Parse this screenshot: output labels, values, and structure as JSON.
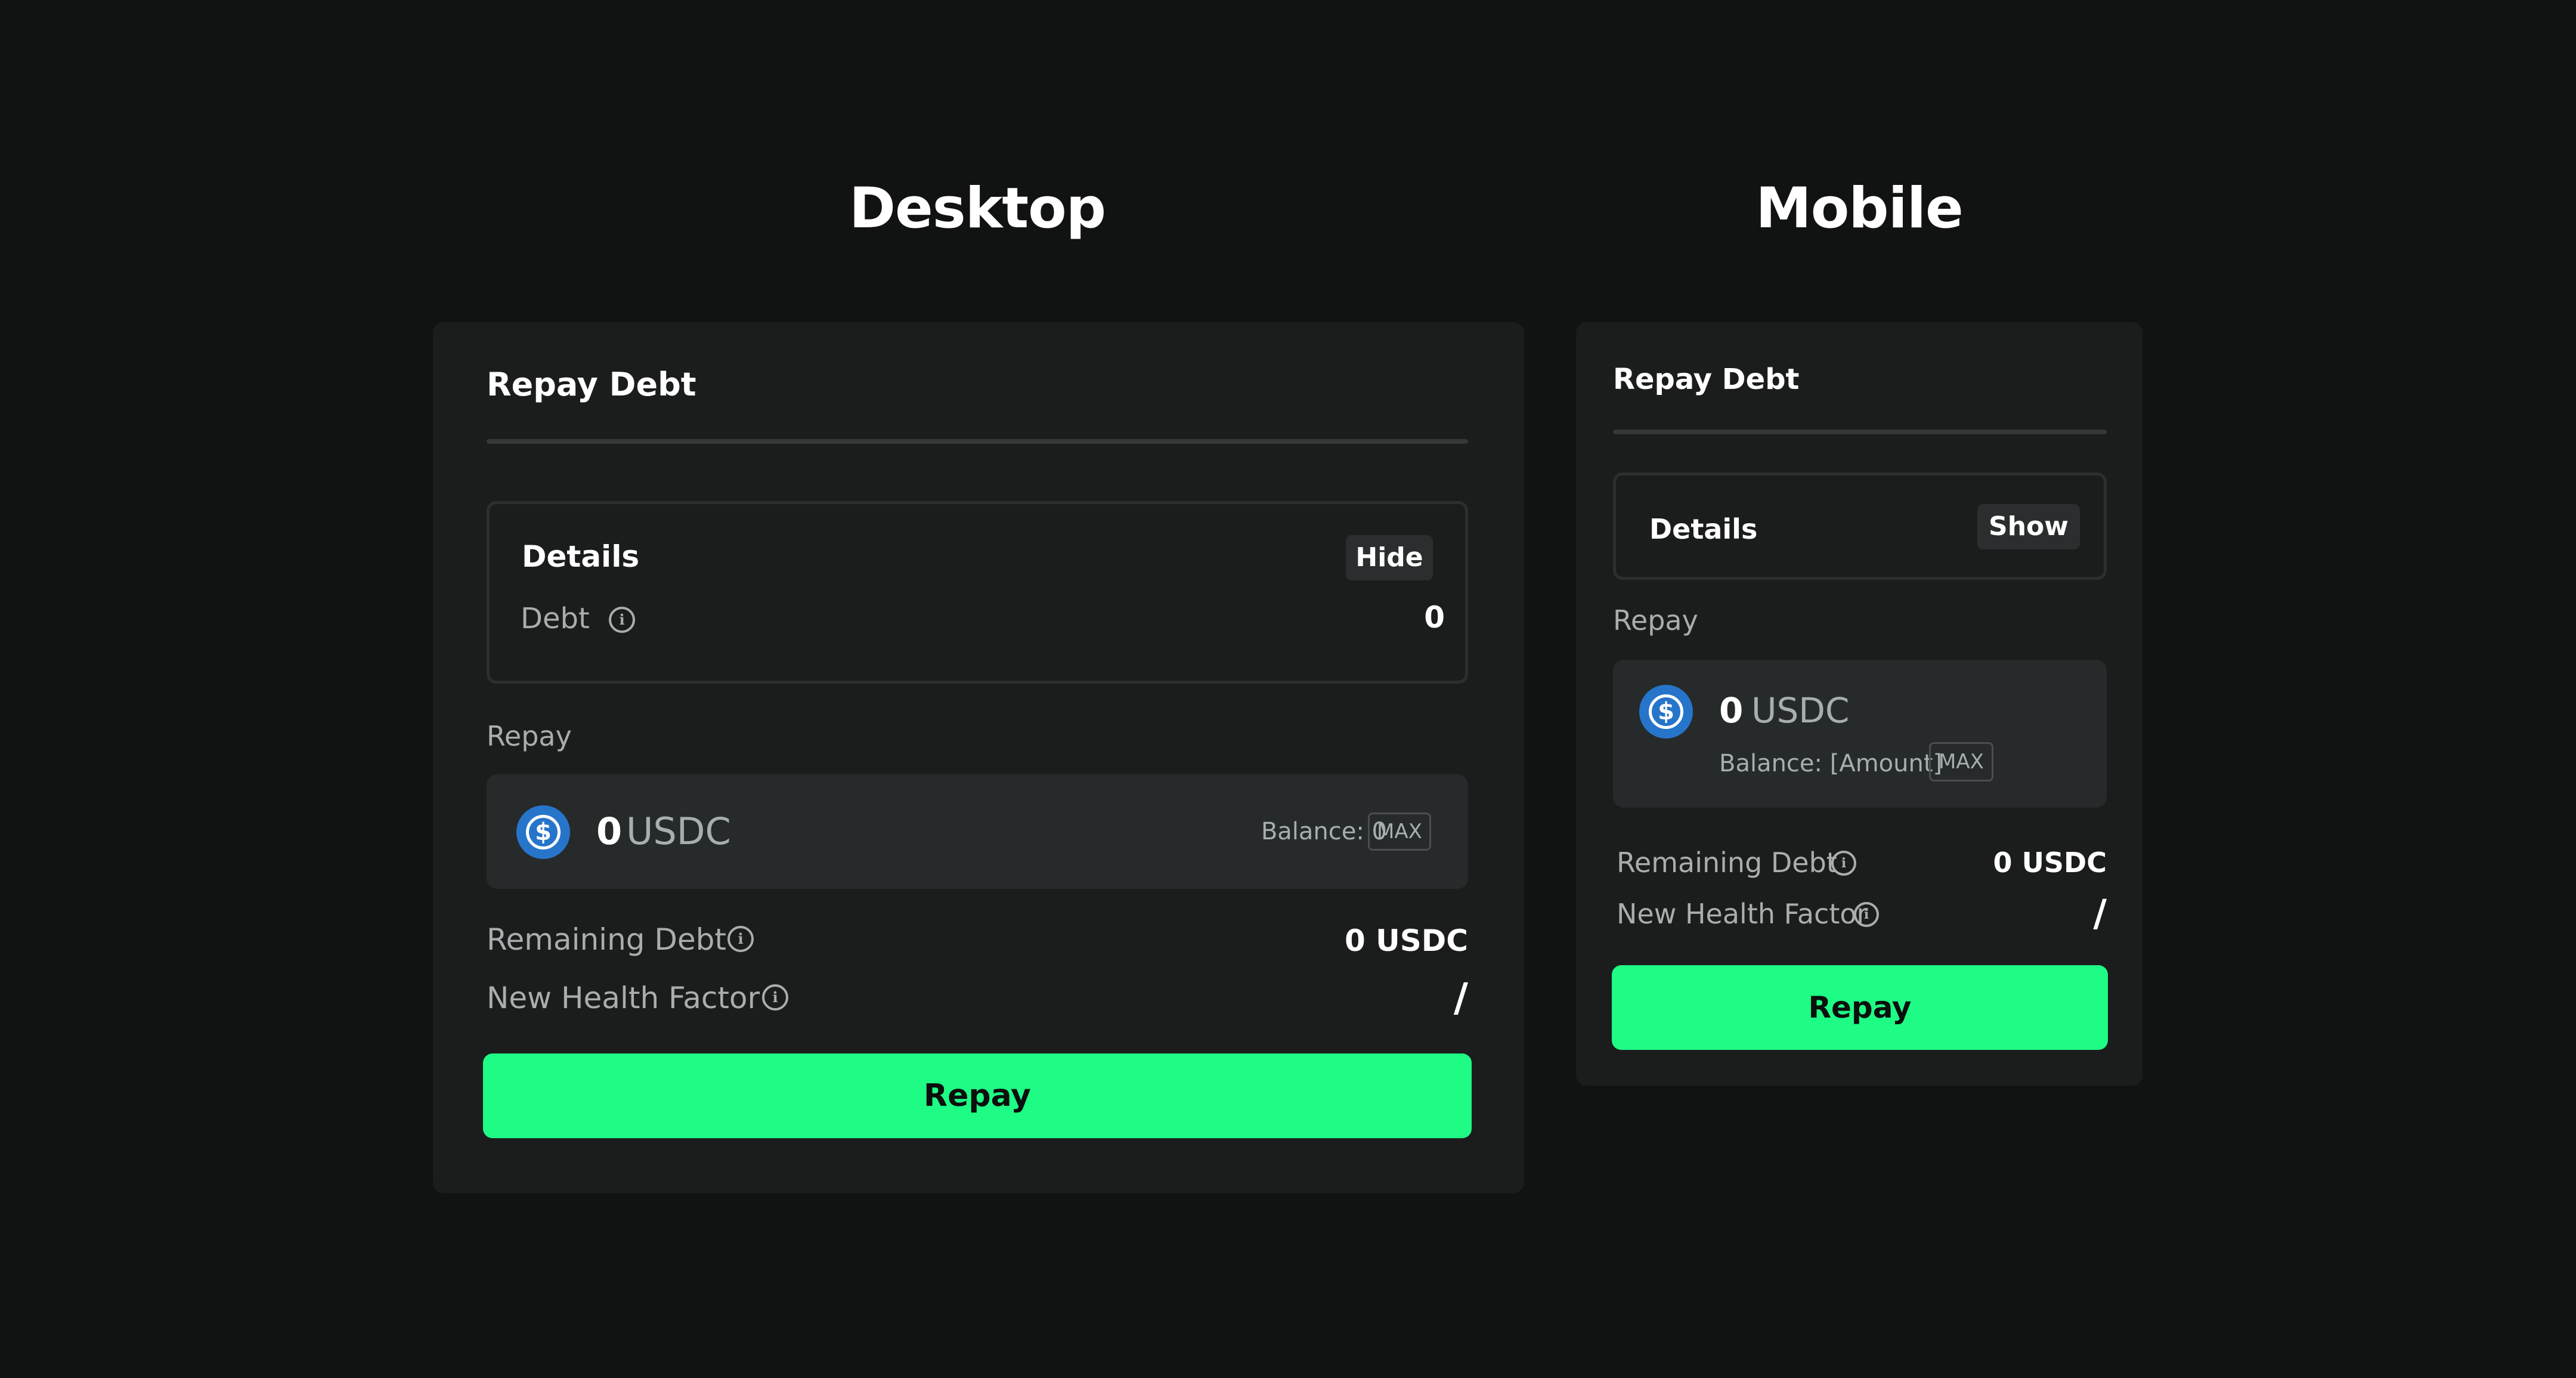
{
  "headings": {
    "desktop": "Desktop",
    "mobile": "Mobile"
  },
  "desktop": {
    "title": "Repay Debt",
    "details": {
      "title": "Details",
      "toggle_label": "Hide",
      "debt_label": "Debt",
      "debt_value": "0"
    },
    "repay_label": "Repay",
    "input": {
      "amount": "0",
      "token": "USDC",
      "balance": "Balance: 0",
      "max_label": "MAX"
    },
    "remaining_debt_label": "Remaining Debt",
    "remaining_debt_value": "0 USDC",
    "health_factor_label": "New Health Factor",
    "health_factor_value": "/",
    "button_label": "Repay"
  },
  "mobile": {
    "title": "Repay Debt",
    "details": {
      "title": "Details",
      "toggle_label": "Show"
    },
    "repay_label": "Repay",
    "input": {
      "amount": "0",
      "token": "USDC",
      "balance": "Balance: [Amount]",
      "max_label": "MAX"
    },
    "remaining_debt_label": "Remaining Debt",
    "remaining_debt_value": "0 USDC",
    "health_factor_label": "New Health Factor",
    "health_factor_value": "/",
    "button_label": "Repay"
  },
  "icons": {
    "info": "info-icon",
    "token": "usdc-icon"
  },
  "colors": {
    "background": "#111212",
    "card": "#1b1d1d",
    "accent": "#1efc85",
    "usdc": "#2775ca"
  }
}
